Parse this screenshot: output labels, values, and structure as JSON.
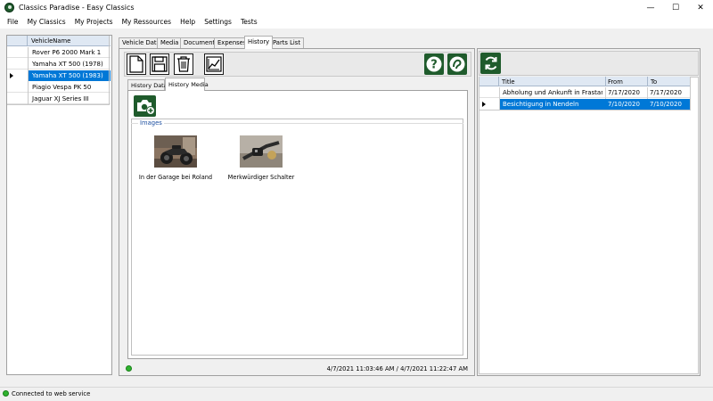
{
  "window": {
    "title": "Classics Paradise - Easy Classics",
    "minimize": "—",
    "maximize": "☐",
    "close": "✕"
  },
  "menu": [
    "File",
    "My Classics",
    "My Projects",
    "My Ressources",
    "Help",
    "Settings",
    "Tests"
  ],
  "vehicles": {
    "header": "VehicleName",
    "rows": [
      "Rover P6 2000 Mark 1",
      "Yamaha  XT 500 (1978)",
      "Yamaha XT 500 (1983)",
      "Piagio Vespa PK 50",
      "Jaguar XJ Series III"
    ],
    "selected_index": 2
  },
  "main_tabs": [
    "Vehicle Data",
    "Media",
    "Documents",
    "Expenses",
    "History",
    "Parts List"
  ],
  "main_tab_active": 4,
  "sub_tabs": [
    "History Data",
    "History Media"
  ],
  "sub_tab_active": 1,
  "media": {
    "group_label": "Images",
    "items": [
      {
        "caption": "In der Garage bei Roland"
      },
      {
        "caption": "Merkwürdiger Schalter"
      }
    ]
  },
  "status_inner": {
    "timestamps": "4/7/2021 11:03:46 AM / 4/7/2021 11:22:47 AM"
  },
  "history_table": {
    "headers": [
      "Title",
      "From",
      "To"
    ],
    "rows": [
      {
        "title": "Abholung und Ankunft in Frastanz",
        "from": "7/17/2020",
        "to": "7/17/2020"
      },
      {
        "title": "Besichtigung in Nendeln",
        "from": "7/10/2020",
        "to": "7/10/2020"
      }
    ],
    "selected_index": 1
  },
  "statusbar": {
    "text": "Connected to web service"
  },
  "colors": {
    "accent_green": "#1f5b2c",
    "selection_blue": "#0078d7",
    "status_green": "#2fb32f"
  }
}
